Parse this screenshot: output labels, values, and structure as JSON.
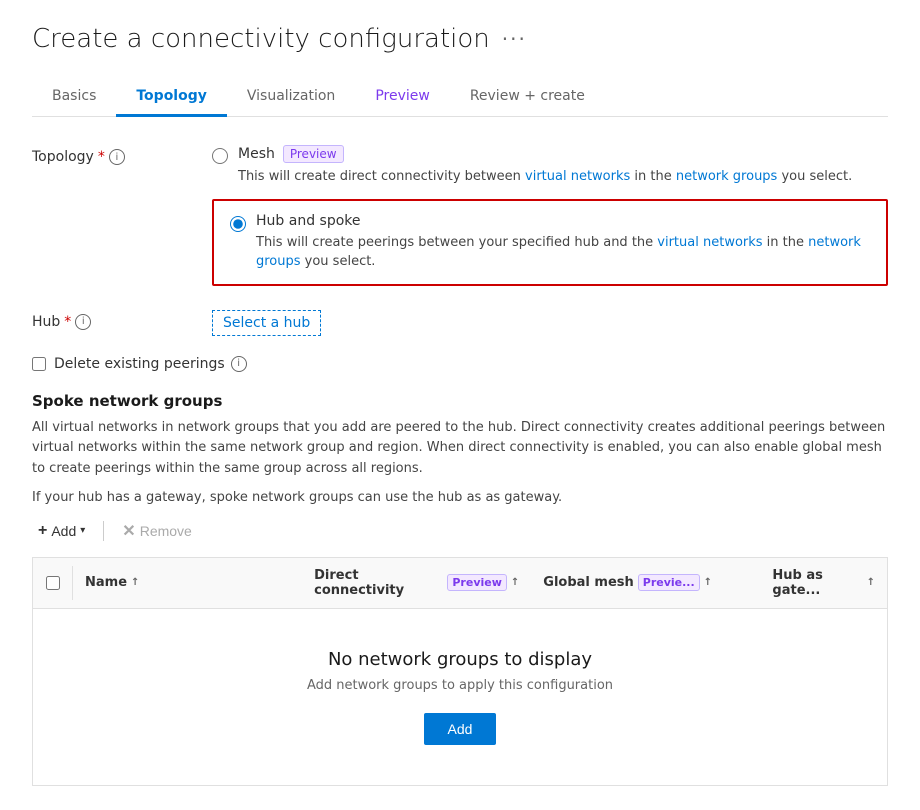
{
  "page": {
    "title": "Create a connectivity configuration",
    "more_icon_label": "···"
  },
  "tabs": [
    {
      "id": "basics",
      "label": "Basics",
      "active": false,
      "preview": false
    },
    {
      "id": "topology",
      "label": "Topology",
      "active": true,
      "preview": false
    },
    {
      "id": "visualization",
      "label": "Visualization",
      "active": false,
      "preview": false
    },
    {
      "id": "preview",
      "label": "Preview",
      "active": false,
      "preview": true
    },
    {
      "id": "review",
      "label": "Review + create",
      "active": false,
      "preview": false
    }
  ],
  "topology": {
    "field_label": "Topology",
    "required": "*",
    "options": [
      {
        "id": "mesh",
        "label": "Mesh",
        "preview": true,
        "preview_label": "Preview",
        "description": "This will create direct connectivity between virtual networks in the network groups you select.",
        "selected": false
      },
      {
        "id": "hub_spoke",
        "label": "Hub and spoke",
        "preview": false,
        "description": "This will create peerings between your specified hub and the virtual networks in the network groups you select.",
        "selected": true
      }
    ]
  },
  "hub": {
    "field_label": "Hub",
    "required": "*",
    "select_link_label": "Select a hub"
  },
  "delete_existing": {
    "label": "Delete existing peerings"
  },
  "spoke_network_groups": {
    "heading": "Spoke network groups",
    "description1": "All virtual networks in network groups that you add are peered to the hub. Direct connectivity creates additional peerings between virtual networks within the same network group and region. When direct connectivity is enabled, you can also enable global mesh to create peerings within the same group across all regions.",
    "description2": "If your hub has a gateway, spoke network groups can use the hub as as gateway.",
    "toolbar": {
      "add_label": "Add",
      "remove_label": "Remove"
    },
    "table": {
      "columns": [
        {
          "id": "name",
          "label": "Name",
          "sort": true
        },
        {
          "id": "direct_connectivity",
          "label": "Direct connectivity",
          "preview": true,
          "sort": true
        },
        {
          "id": "global_mesh",
          "label": "Global mesh",
          "preview": true,
          "preview_truncated": "Previe...",
          "sort": true
        },
        {
          "id": "hub_as_gate",
          "label": "Hub as gate...",
          "sort": true
        }
      ],
      "rows": []
    },
    "empty_state": {
      "title": "No network groups to display",
      "subtitle": "Add network groups to apply this configuration",
      "add_button_label": "Add"
    }
  }
}
